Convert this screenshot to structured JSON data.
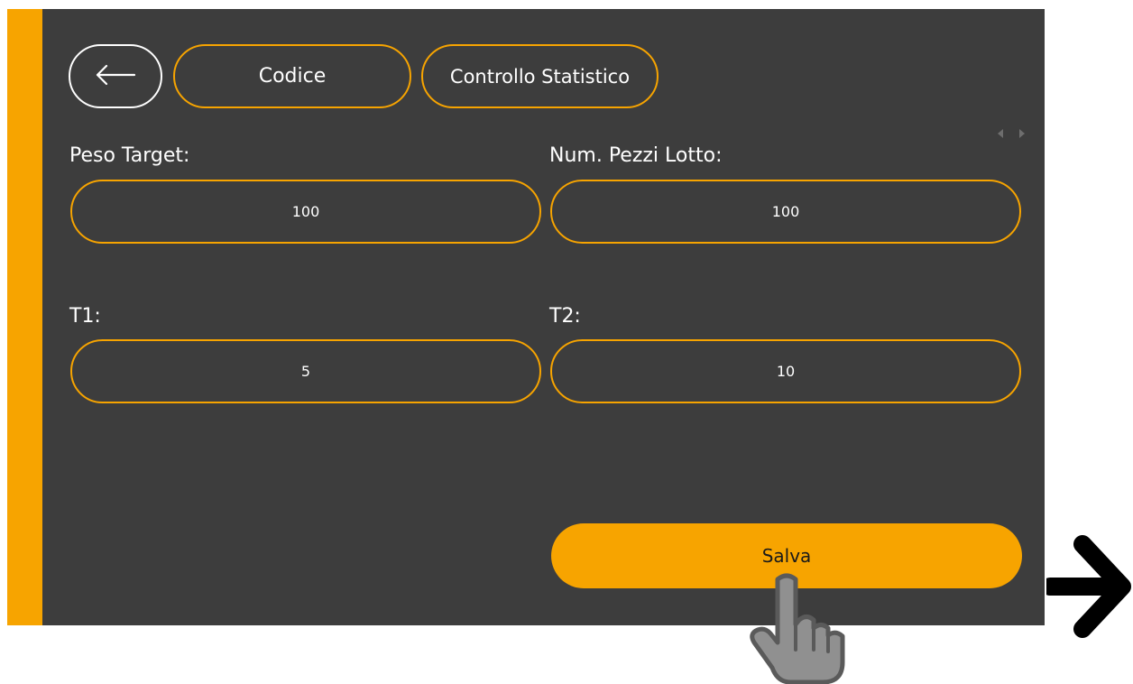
{
  "header": {
    "back_icon": "arrow-left-icon",
    "code_label": "Codice",
    "stats_label": "Controllo Statistico"
  },
  "fields": {
    "peso_target": {
      "label": "Peso Target:",
      "value": "100"
    },
    "num_pezzi_lotto": {
      "label": "Num. Pezzi Lotto:",
      "value": "100"
    },
    "t1": {
      "label": "T1:",
      "value": "5"
    },
    "t2": {
      "label": "T2:",
      "value": "10"
    }
  },
  "actions": {
    "save_label": "Salva"
  },
  "annotations": {
    "pointer_icon": "hand-pointer-icon",
    "next_icon": "arrow-right-icon"
  },
  "colors": {
    "accent": "#f7a400",
    "panel_background": "#3d3d3d",
    "text": "#ffffff"
  }
}
